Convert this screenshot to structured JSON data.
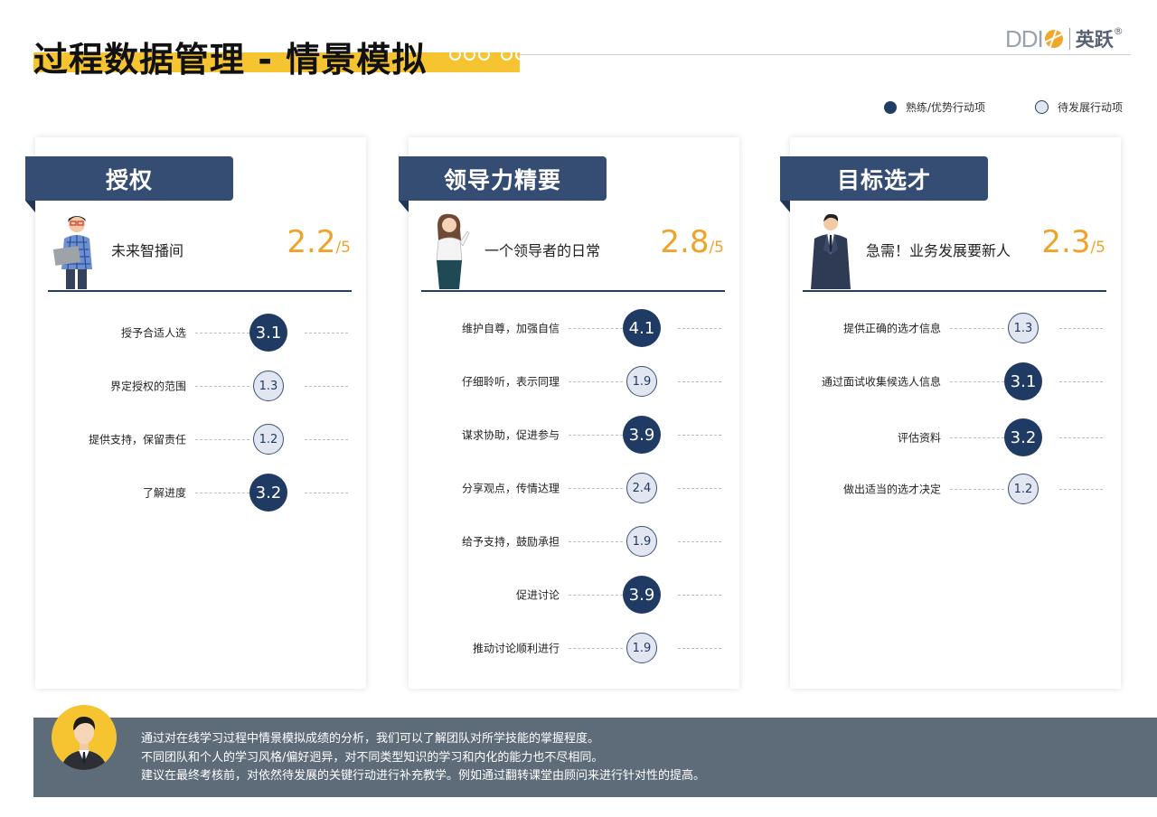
{
  "header": {
    "title": "过程数据管理 - 情景模拟",
    "logo_text": "DDI",
    "logo_cn": "英跃",
    "logo_mark": "®"
  },
  "legend": [
    {
      "label": "熟练/优势行动项",
      "kind": "strong"
    },
    {
      "label": "待发展行动项",
      "kind": "develop"
    }
  ],
  "cards": [
    {
      "tab": "授权",
      "scenario": "未来智播间",
      "score": "2.2",
      "score_total": "/5",
      "avatar": "man-with-laptop",
      "items": [
        {
          "label": "授予合适人选",
          "value": "3.1",
          "kind": "strong"
        },
        {
          "label": "界定授权的范围",
          "value": "1.3",
          "kind": "develop"
        },
        {
          "label": "提供支持，保留责任",
          "value": "1.2",
          "kind": "develop"
        },
        {
          "label": "了解进度",
          "value": "3.2",
          "kind": "strong"
        }
      ]
    },
    {
      "tab": "领导力精要",
      "scenario": "一个领导者的日常",
      "score": "2.8",
      "score_total": "/5",
      "avatar": "businesswoman",
      "items": [
        {
          "label": "维护自尊，加强自信",
          "value": "4.1",
          "kind": "strong"
        },
        {
          "label": "仔细聆听，表示同理",
          "value": "1.9",
          "kind": "develop"
        },
        {
          "label": "谋求协助，促进参与",
          "value": "3.9",
          "kind": "strong"
        },
        {
          "label": "分享观点，传情达理",
          "value": "2.4",
          "kind": "develop"
        },
        {
          "label": "给予支持，鼓励承担",
          "value": "1.9",
          "kind": "develop"
        },
        {
          "label": "促进讨论",
          "value": "3.9",
          "kind": "strong"
        },
        {
          "label": "推动讨论顺利进行",
          "value": "1.9",
          "kind": "develop"
        }
      ]
    },
    {
      "tab": "目标选才",
      "scenario": "急需！业务发展要新人",
      "score": "2.3",
      "score_total": "/5",
      "avatar": "businessman-in-suit",
      "items": [
        {
          "label": "提供正确的选才信息",
          "value": "1.3",
          "kind": "develop"
        },
        {
          "label": "通过面试收集候选人信息",
          "value": "3.1",
          "kind": "strong"
        },
        {
          "label": "评估资料",
          "value": "3.2",
          "kind": "strong"
        },
        {
          "label": "做出适当的选才决定",
          "value": "1.2",
          "kind": "develop"
        }
      ]
    }
  ],
  "footer": {
    "avatar": "consultant-avatar",
    "lines": [
      "通过对在线学习过程中情景模拟成绩的分析，我们可以了解团队对所学技能的掌握程度。",
      "不同团队和个人的学习风格/偏好迥异，对不同类型知识的学习和内化的能力也不尽相同。",
      "建议在最终考核前，对依然待发展的关键行动进行补充教学。例如通过翻转课堂由顾问来进行针对性的提高。"
    ]
  }
}
